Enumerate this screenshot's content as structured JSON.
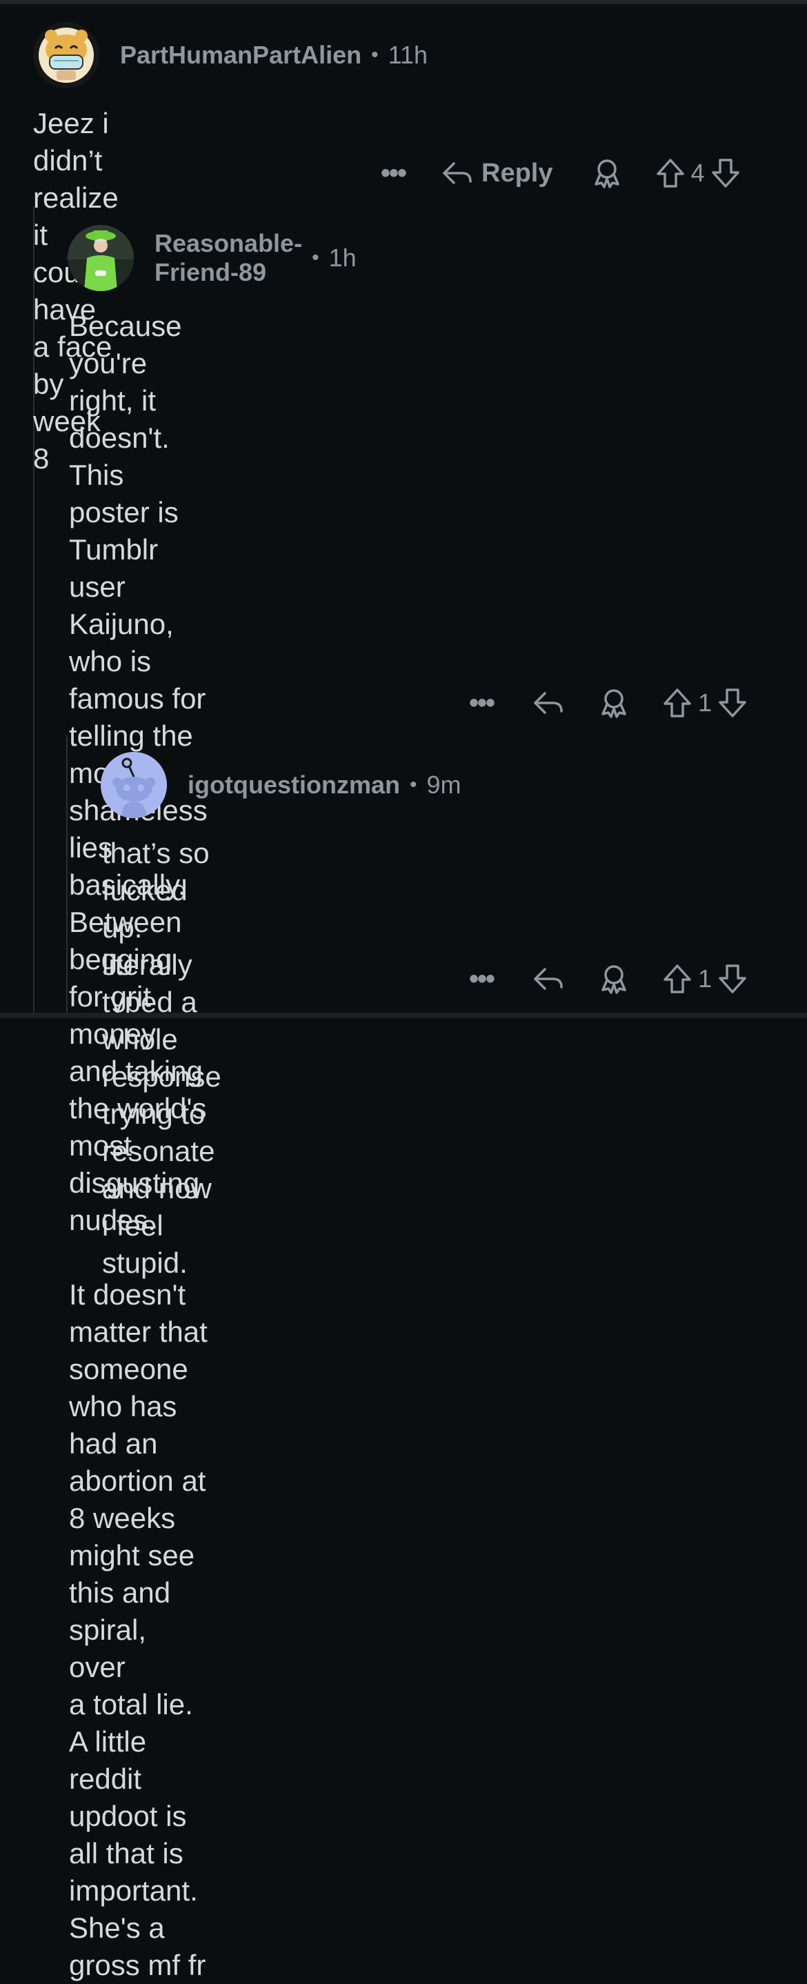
{
  "comments": [
    {
      "username": "PartHumanPartAlien",
      "time": "11h",
      "body": "Jeez i didn’t realize it could have a face by week 8",
      "reply_label": "Reply",
      "votes": "4",
      "avatar_icon": "cartoon-bear-mask-avatar"
    },
    {
      "username": "Reasonable-Friend-89",
      "time": "1h",
      "body": "Because you're right, it doesn't. This poster is\nTumblr user Kaijuno, who is famous for telling the\nmost shameless lies basically. Between begging\nfor grit money and taking the world's most\ndisgusting nudes.\n\nIt doesn't matter that someone who has had an\nabortion at 8 weeks might see this and spiral, over\na total lie. A little reddit updoot is all that is\nimportant.  She's a gross mf fr",
      "votes": "1",
      "avatar_icon": "woman-green-outfit-avatar"
    },
    {
      "username": "igotquestionzman",
      "time": "9m",
      "body": "that’s so fucked up. literally typed a whole\nresponse trying to resonate and now i feel\nstupid.",
      "votes": "1",
      "avatar_icon": "default-snoo-avatar"
    }
  ],
  "icons": {
    "more": "more-dots-icon",
    "reply": "reply-arrow-icon",
    "award": "award-icon",
    "upvote": "upvote-arrow-icon",
    "downvote": "downvote-arrow-icon"
  },
  "colors": {
    "background": "#0b0e11",
    "text": "#d7dadc",
    "muted": "#8f979e",
    "thread_line": "#2b2f33",
    "snoo_avatar_bg": "#a8b7f0"
  }
}
